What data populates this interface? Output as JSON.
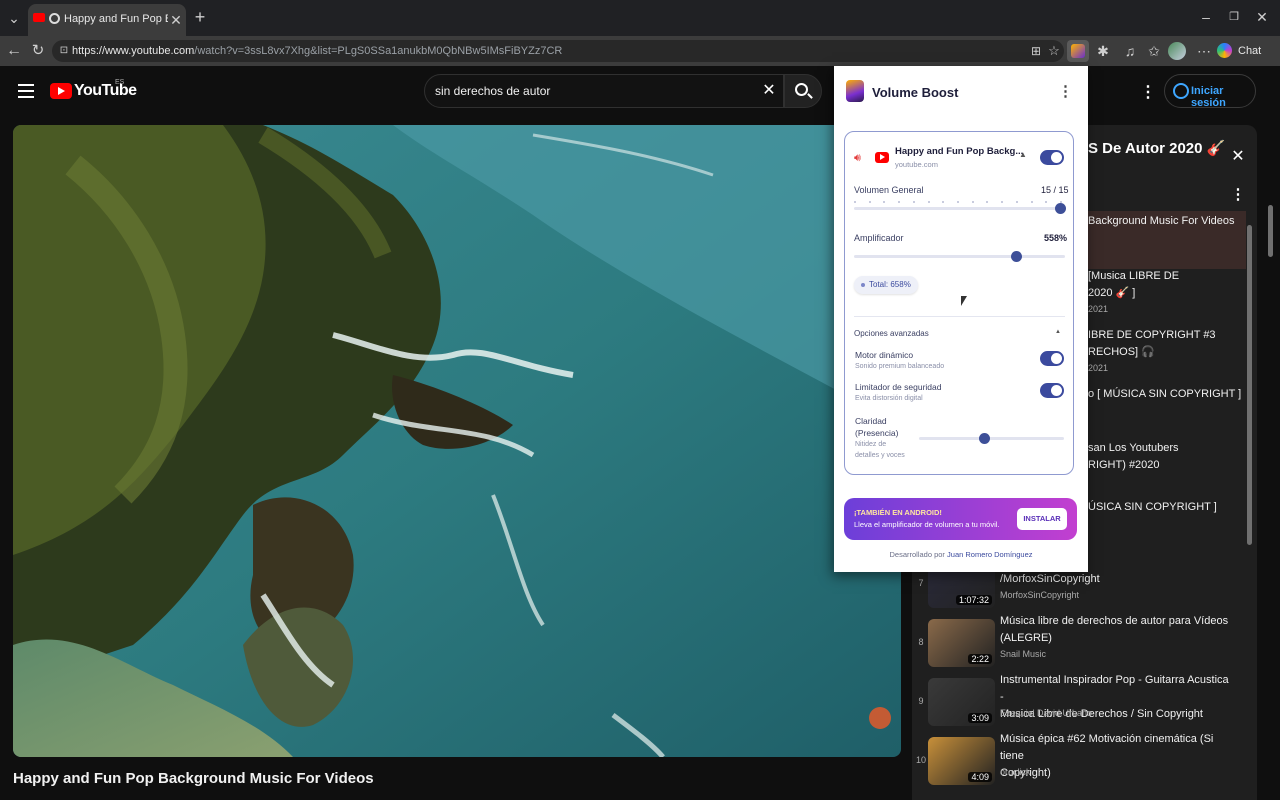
{
  "browser": {
    "tab_title": "Happy and Fun Pop Backgrou",
    "url_host": "https://www.youtube.com",
    "url_path": "/watch?v=3ssL8vx7Xhg&list=PLgS0SSa1anukbM0QbNBw5IMsFiBYZz7CR",
    "chat_label": "Chat"
  },
  "youtube": {
    "logo_text": "YouTube",
    "region": "ES",
    "search_value": "sin derechos de autor",
    "signin_label": "Iniciar sesión",
    "video_title": "Happy and Fun Pop Background Music For Videos",
    "playlist_title": "S De Autor 2020 🎸",
    "playlist": [
      {
        "index": "",
        "title": "Background Music For Videos",
        "channel": "",
        "duration": "",
        "partial": true
      },
      {
        "index": "",
        "title": "[Musica LIBRE DE\n2020 🎸 ]",
        "channel": "2021",
        "duration": "",
        "partial": true
      },
      {
        "index": "",
        "title": "IBRE DE COPYRIGHT #3\nRECHOS] 🎧",
        "channel": "2021",
        "duration": "",
        "partial": true
      },
      {
        "index": "",
        "title": "o [ MÚSICA SIN COPYRIGHT ]",
        "channel": "",
        "duration": "",
        "partial": true
      },
      {
        "index": "",
        "title": "san Los Youtubers\nRIGHT) #2020",
        "channel": "",
        "duration": "",
        "partial": true
      },
      {
        "index": "",
        "title": "ÚSICA SIN COPYRIGHT ]",
        "channel": "",
        "duration": "",
        "partial": true
      },
      {
        "index": "7",
        "title": "n Copyright 2020\n/MorfoxSinCopyright",
        "channel": "MorfoxSinCopyright",
        "duration": "1:07:32",
        "partial": true
      },
      {
        "index": "8",
        "title": "Música libre de derechos de autor para Vídeos\n(ALEGRE)",
        "channel": "Snail Music",
        "duration": "2:22",
        "partial": false
      },
      {
        "index": "9",
        "title": "Instrumental Inspirador Pop - Guitarra Acustica -\nMusica Libre de Derechos / Sin Copyright",
        "channel": "Ezequiel David Urbano",
        "duration": "3:09",
        "partial": false
      },
      {
        "index": "10",
        "title": "Música épica #62 Motivación cinemática (Si tiene\nCopyright)",
        "channel": "oroclick",
        "duration": "4:09",
        "partial": false
      }
    ]
  },
  "extension": {
    "name": "Volume Boost",
    "site_title": "Happy and Fun Pop Backg...",
    "site_host": "youtube.com",
    "general_label": "Volumen General",
    "general_value": "15 / 15",
    "general_level": 1.0,
    "amp_label": "Amplificador",
    "amp_value": "558%",
    "amp_level": 0.77,
    "total_label": "Total: 658%",
    "advanced_label": "Opciones avanzadas",
    "options": [
      {
        "title": "Motor dinámico",
        "desc": "Sonido premium balanceado",
        "on": true
      },
      {
        "title": "Limitador de seguridad",
        "desc": "Evita distorsión digital",
        "on": true
      }
    ],
    "clarity_title": "Claridad\n(Presencia)",
    "clarity_desc": "Nitidez de\ndetalles y voces",
    "clarity_level": 0.45,
    "promo_title": "¡TAMBIÉN EN ANDROID!",
    "promo_text": "Lleva el amplificador de volumen a tu móvil.",
    "install_label": "INSTALAR",
    "footer_prefix": "Desarrollado por",
    "footer_author": "Juan Romero Domínguez"
  },
  "colors": {
    "accent": "#3b4a9e",
    "youtube_red": "#ff0000",
    "promo_start": "#6c3fd9",
    "promo_end": "#c23fd0"
  }
}
